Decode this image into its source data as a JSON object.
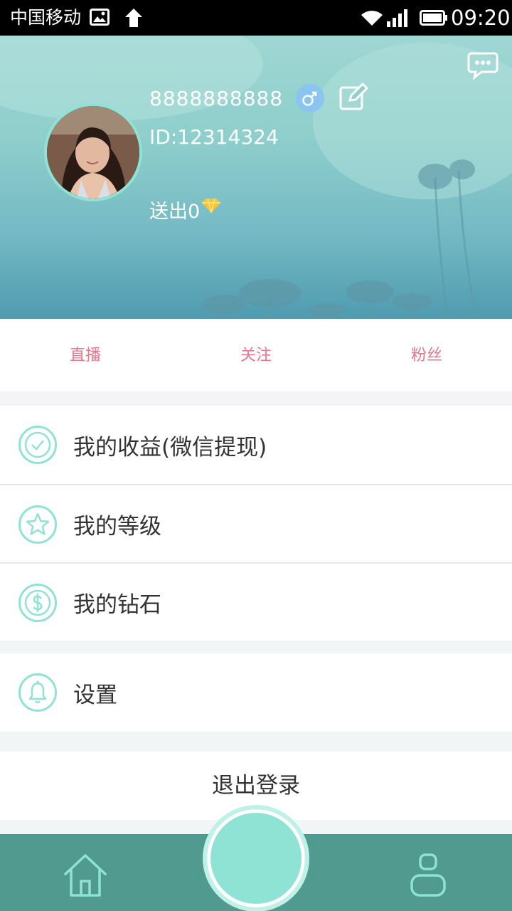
{
  "status_bar": {
    "carrier": "中国移动",
    "time": "09:20",
    "icons": [
      "image-icon",
      "upload-arrow-icon",
      "wifi-icon",
      "signal-icon",
      "battery-icon"
    ]
  },
  "profile": {
    "username": "8888888888",
    "user_id": "ID:12314324",
    "sent_label": "送出0",
    "gender": "male",
    "colors": {
      "gender_badge": "#8cc4f0",
      "avatar_ring": "#8fe3d4"
    }
  },
  "tabs": [
    {
      "label": "直播"
    },
    {
      "label": "关注"
    },
    {
      "label": "粉丝"
    }
  ],
  "menu": {
    "group1": [
      {
        "label": "我的收益(微信提现)",
        "icon": "check-circle-icon"
      },
      {
        "label": "我的等级",
        "icon": "star-circle-icon"
      },
      {
        "label": "我的钻石",
        "icon": "dollar-circle-icon"
      }
    ],
    "group2": [
      {
        "label": "设置",
        "icon": "bell-icon"
      }
    ]
  },
  "logout_label": "退出登录",
  "bottom_nav": {
    "items": [
      "home-icon",
      "live-center-button",
      "profile-icon"
    ],
    "colors": {
      "bar": "#519a8f",
      "accent": "#8fe3d4"
    }
  },
  "colors": {
    "tab_text": "#e8768c",
    "menu_icon": "#8fe3d4"
  }
}
